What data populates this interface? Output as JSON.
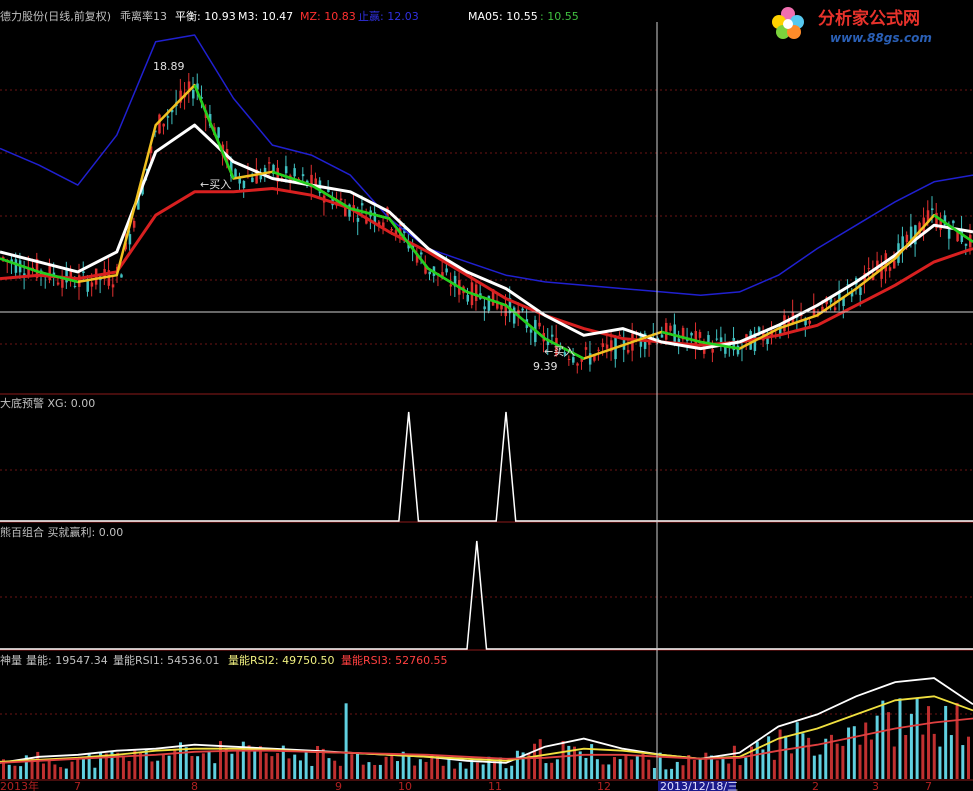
{
  "stock_name": "德力股份(日线,前复权)",
  "logo": {
    "title": "分析家公式网",
    "url": "www.88gs.com"
  },
  "colors": {
    "background": "#000000",
    "separator": "#8b1a1a",
    "grid": "#8b1a1a",
    "up": "#e03030",
    "down": "#40c0c0",
    "white": "#ffffff",
    "blue": "#2020d0",
    "red_ma": "#d82020",
    "yellow": "#f0c020",
    "green": "#20d020",
    "cursor": "#e0e0e0"
  },
  "main": {
    "title_items": [
      {
        "label": "乖离率13",
        "color": "#c0c0c0"
      },
      {
        "label": "平衡: 10.93",
        "color": "#ffffff"
      },
      {
        "label": "M3: 10.47",
        "color": "#ffffff"
      },
      {
        "label": "MZ: 10.83",
        "color": "#ff3030"
      },
      {
        "label": "止赢: 12.03",
        "color": "#3030e0"
      },
      {
        "label": "MA05: 10.55",
        "color": "#ffffff"
      },
      {
        "label": ": 10.55",
        "color": "#40c040"
      }
    ],
    "annotations": {
      "high_label": "18.89",
      "low_label": "9.39",
      "buy_label_1": "←买入",
      "buy_label_2": "←买入"
    }
  },
  "panel2": {
    "title": "大底预警",
    "value_label": "XG: 0.00"
  },
  "panel3": {
    "title": "熊百组合",
    "value_label": "买就赢利: 0.00"
  },
  "panel4": {
    "title": "神量",
    "items": [
      {
        "label": "量能: 19547.34",
        "color": "#c0c0c0"
      },
      {
        "label": "量能RSI1: 54536.01",
        "color": "#c0c0c0"
      },
      {
        "label": "量能RSI2: 49750.50",
        "color": "#f0f080"
      },
      {
        "label": "量能RSI3: 52760.55",
        "color": "#ff4040"
      }
    ]
  },
  "x_axis": {
    "labels": [
      "2013年",
      "7",
      "8",
      "9",
      "10",
      "11",
      "12",
      "2013/12/18/三",
      "2",
      "3",
      "7"
    ]
  },
  "chart_data": [
    {
      "type": "line",
      "name": "price-panel",
      "x": [
        0,
        4,
        8,
        12,
        16,
        20,
        24,
        28,
        32,
        36,
        40,
        44,
        48,
        52,
        56,
        60,
        64,
        68,
        72,
        76,
        80,
        84,
        88,
        92,
        96,
        100
      ],
      "ylim": [
        9.0,
        20.0
      ],
      "series": [
        {
          "name": "白线",
          "color": "#ffffff",
          "values": [
            13.2,
            12.9,
            12.6,
            13.2,
            16.2,
            17.0,
            15.9,
            15.4,
            15.2,
            15.0,
            14.4,
            13.3,
            12.6,
            12.1,
            11.3,
            10.7,
            10.9,
            10.5,
            10.3,
            10.5,
            11.0,
            11.6,
            12.3,
            13.1,
            14.0,
            13.8
          ]
        },
        {
          "name": "红线",
          "color": "#d82020",
          "values": [
            12.4,
            12.5,
            12.4,
            12.6,
            14.3,
            15.0,
            15.0,
            15.1,
            14.9,
            14.5,
            13.8,
            13.2,
            12.5,
            11.8,
            11.3,
            10.9,
            10.6,
            10.5,
            10.4,
            10.5,
            10.7,
            11.0,
            11.6,
            12.2,
            12.9,
            13.3
          ]
        },
        {
          "name": "蓝线",
          "color": "#2020d0",
          "values": [
            16.3,
            15.8,
            15.2,
            16.7,
            19.5,
            19.7,
            17.8,
            16.4,
            16.1,
            15.5,
            14.2,
            13.3,
            12.9,
            12.5,
            12.3,
            12.2,
            12.1,
            12.0,
            11.9,
            12.0,
            12.5,
            13.3,
            14.0,
            14.7,
            15.3,
            15.5
          ]
        },
        {
          "name": "均线",
          "color": "#f0c020",
          "values": [
            13.0,
            12.6,
            12.3,
            12.5,
            17.0,
            18.2,
            15.4,
            15.6,
            15.2,
            14.5,
            14.2,
            12.7,
            12.0,
            11.6,
            10.6,
            10.0,
            10.4,
            10.8,
            10.5,
            10.3,
            10.9,
            11.3,
            12.1,
            13.0,
            14.3,
            13.5
          ]
        }
      ]
    },
    {
      "type": "line",
      "name": "大底预警",
      "x": [
        0,
        41,
        42,
        43,
        51,
        52,
        53,
        100
      ],
      "series": [
        {
          "name": "XG",
          "values": [
            0,
            0,
            1,
            0,
            0,
            1,
            0,
            0
          ]
        }
      ],
      "ylim": [
        0,
        1
      ]
    },
    {
      "type": "line",
      "name": "熊百组合",
      "x": [
        0,
        48,
        49,
        50,
        100
      ],
      "series": [
        {
          "name": "买就赢利",
          "values": [
            0,
            0,
            1,
            0,
            0
          ]
        }
      ],
      "ylim": [
        0,
        1
      ]
    },
    {
      "type": "bar",
      "name": "神量",
      "x": [
        0,
        4,
        8,
        12,
        16,
        20,
        24,
        28,
        32,
        36,
        40,
        44,
        48,
        52,
        56,
        60,
        64,
        68,
        72,
        76,
        80,
        84,
        88,
        92,
        96,
        100
      ],
      "series": [
        {
          "name": "量能",
          "values": [
            18000,
            20000,
            19000,
            22000,
            26000,
            28000,
            27000,
            25000,
            24000,
            23000,
            21000,
            20000,
            17000,
            16000,
            30000,
            27000,
            22000,
            19000,
            18000,
            24000,
            38000,
            45000,
            56000,
            60000,
            58000,
            54000
          ]
        },
        {
          "name": "量能RSI1",
          "values": [
            16000,
            22000,
            24000,
            28000,
            30000,
            34000,
            32000,
            30000,
            28000,
            26000,
            24000,
            22000,
            18000,
            16000,
            32000,
            40000,
            30000,
            24000,
            20000,
            26000,
            52000,
            64000,
            82000,
            96000,
            100000,
            74000
          ]
        },
        {
          "name": "量能RSI2",
          "values": [
            17000,
            19000,
            21000,
            24000,
            28000,
            30000,
            30000,
            29000,
            27000,
            26000,
            24000,
            22000,
            20000,
            18000,
            24000,
            30000,
            28000,
            24000,
            20000,
            22000,
            40000,
            50000,
            64000,
            78000,
            82000,
            68000
          ]
        },
        {
          "name": "量能RSI3",
          "values": [
            16000,
            18000,
            20000,
            22000,
            24000,
            27000,
            28000,
            28000,
            27000,
            26000,
            25000,
            24000,
            22000,
            20000,
            21000,
            24000,
            24000,
            22000,
            20000,
            21000,
            28000,
            34000,
            42000,
            50000,
            56000,
            60000
          ]
        }
      ],
      "ylim": [
        0,
        110000
      ]
    }
  ]
}
